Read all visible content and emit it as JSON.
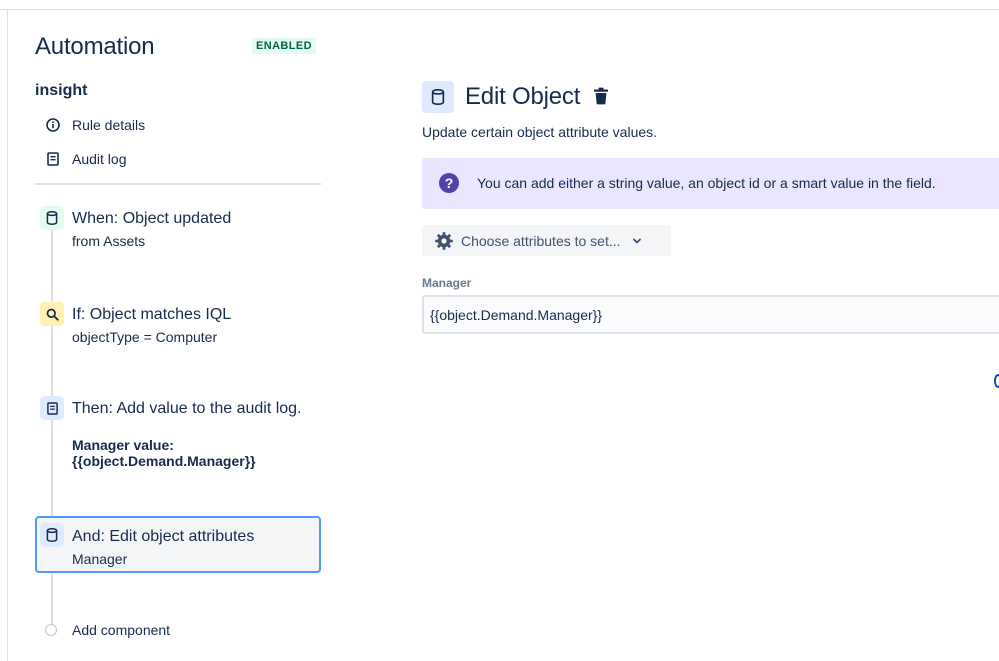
{
  "header": {
    "app_title": "Automation",
    "status_badge": "ENABLED",
    "rule_name": "insight"
  },
  "sidebar": {
    "nav": [
      {
        "label": "Rule details",
        "icon": "info-icon"
      },
      {
        "label": "Audit log",
        "icon": "audit-log-icon"
      }
    ],
    "steps": [
      {
        "title": "When: Object updated",
        "subtitle": "from Assets",
        "icon": "database-icon"
      },
      {
        "title": "If: Object matches IQL",
        "subtitle": "objectType = Computer",
        "icon": "search-icon"
      },
      {
        "title": "Then: Add value to the audit log.",
        "subtitle": "Manager value: {{object.Demand.Manager}}",
        "icon": "audit-log-icon"
      },
      {
        "title": "And: Edit object attributes",
        "subtitle": "Manager",
        "icon": "database-icon",
        "selected": true
      }
    ],
    "add_component_label": "Add component"
  },
  "main": {
    "title": "Edit Object",
    "description": "Update certain object attribute values.",
    "info_message": "You can add either a string value, an object id or a smart value in the field.",
    "choose_button_label": "Choose attributes to set...",
    "field": {
      "label": "Manager",
      "value": "{{object.Demand.Manager}}"
    }
  },
  "colors": {
    "text": "#172b4d",
    "badge_bg": "#e3fcef",
    "badge_text": "#006644",
    "trigger_icon_bg": "#e3fcef",
    "condition_icon_bg": "#fff0b3",
    "action_icon_bg": "#deebff",
    "info_banner_bg": "#eae6ff",
    "info_icon": "#5243aa",
    "selected_border": "#4c9aff"
  }
}
